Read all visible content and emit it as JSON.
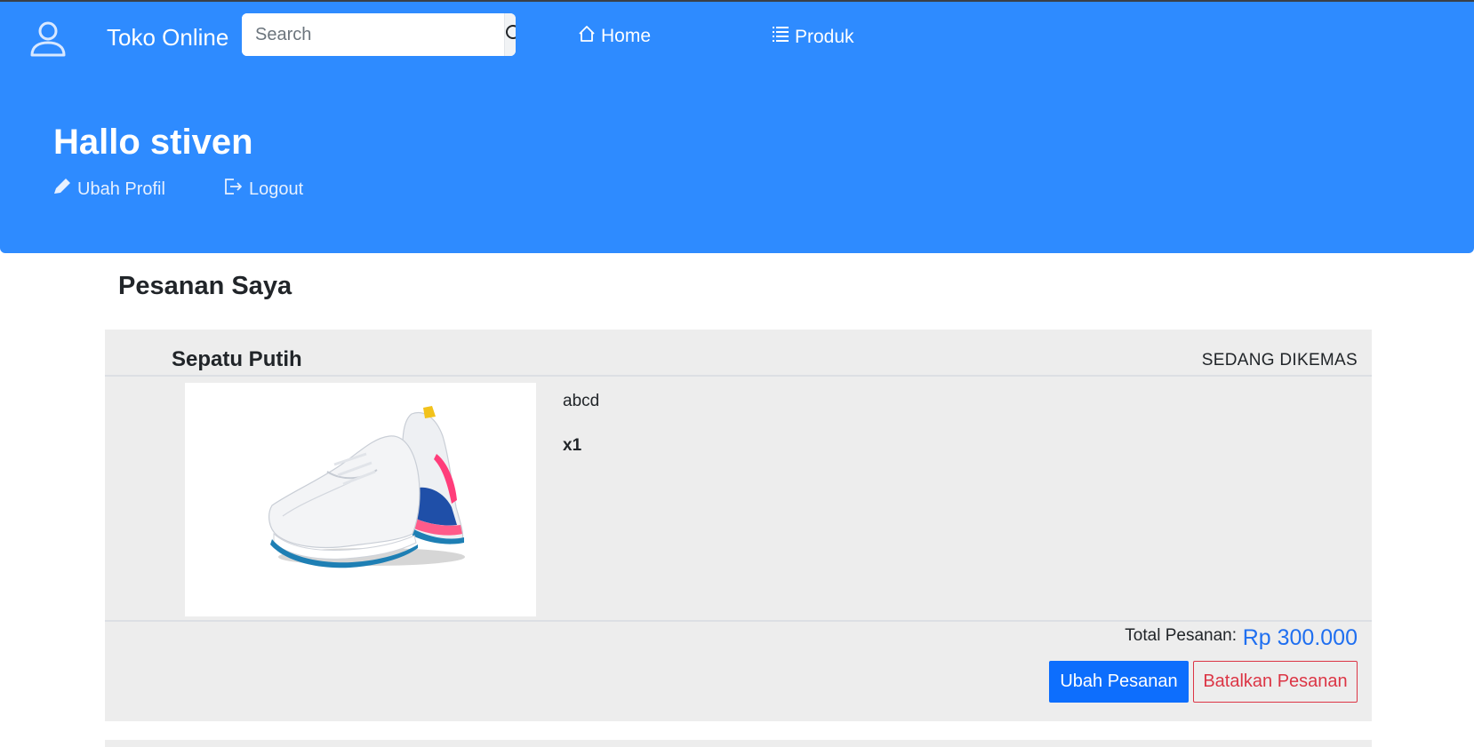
{
  "header": {
    "brand": "Toko Online",
    "search_placeholder": "Search",
    "nav": [
      {
        "label": "Home",
        "icon": "home-icon"
      },
      {
        "label": "Produk",
        "icon": "list-icon"
      }
    ],
    "user_icon": "user-icon"
  },
  "hero": {
    "greeting": "Hallo stiven",
    "links": [
      {
        "label": "Ubah Profil",
        "icon": "pencil-icon"
      },
      {
        "label": "Logout",
        "icon": "logout-icon"
      }
    ]
  },
  "orders": {
    "title": "Pesanan Saya",
    "items": [
      {
        "product_name": "Sepatu Putih",
        "status": "SEDANG DIKEMAS",
        "description": "abcd",
        "quantity": "x1",
        "total_label": "Total Pesanan:",
        "total_value": "Rp 300.000",
        "edit_label": "Ubah Pesanan",
        "cancel_label": "Batalkan Pesanan"
      }
    ]
  },
  "colors": {
    "hero_bg": "#2e8bff",
    "card_bg": "#ededed",
    "primary": "#0d6efd",
    "danger": "#dc3545",
    "price": "#1f6ff0"
  }
}
